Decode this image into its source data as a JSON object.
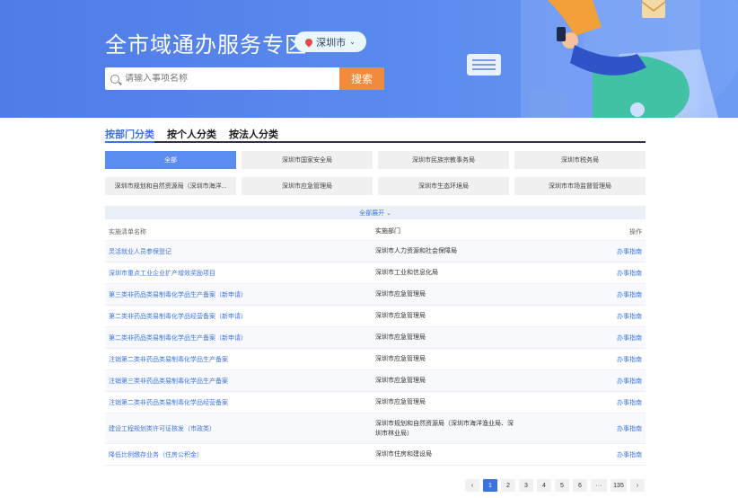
{
  "banner": {
    "title": "全市域通办服务专区",
    "city": "深圳市",
    "search_placeholder": "请输入事项名称",
    "search_button": "搜索"
  },
  "tabs": [
    {
      "label": "按部门分类",
      "active": true
    },
    {
      "label": "按个人分类",
      "active": false
    },
    {
      "label": "按法人分类",
      "active": false
    }
  ],
  "departments": [
    {
      "label": "全部",
      "active": true
    },
    {
      "label": "深圳市国家安全局",
      "active": false
    },
    {
      "label": "深圳市民族宗教事务局",
      "active": false
    },
    {
      "label": "深圳市税务局",
      "active": false
    },
    {
      "label": "深圳市规划和自然资源局（深圳市海洋...",
      "active": false
    },
    {
      "label": "深圳市应急管理局",
      "active": false
    },
    {
      "label": "深圳市生态环境局",
      "active": false
    },
    {
      "label": "深圳市市场监督管理局",
      "active": false
    }
  ],
  "expand_label": "全部展开 ⌄",
  "table": {
    "headers": [
      "实施清单名称",
      "实施部门",
      "操作"
    ],
    "rows": [
      {
        "name": "灵活就业人员参保登记",
        "dept": "深圳市人力资源和社会保障局",
        "action": "办事指南"
      },
      {
        "name": "深圳市重点工业企业扩产增效奖励项目",
        "dept": "深圳市工业和信息化局",
        "action": "办事指南"
      },
      {
        "name": "第三类非药品类易制毒化学品生产备案（新申请）",
        "dept": "深圳市应急管理局",
        "action": "办事指南"
      },
      {
        "name": "第二类非药品类易制毒化学品经营备案（新申请）",
        "dept": "深圳市应急管理局",
        "action": "办事指南"
      },
      {
        "name": "第二类非药品类易制毒化学品生产备案（新申请）",
        "dept": "深圳市应急管理局",
        "action": "办事指南"
      },
      {
        "name": "注销第二类非药品类易制毒化学品生产备案",
        "dept": "深圳市应急管理局",
        "action": "办事指南"
      },
      {
        "name": "注销第三类非药品类易制毒化学品生产备案",
        "dept": "深圳市应急管理局",
        "action": "办事指南"
      },
      {
        "name": "注销第二类非药品类易制毒化学品经营备案",
        "dept": "深圳市应急管理局",
        "action": "办事指南"
      },
      {
        "name": "建设工程规划类许可证核发（市政类）",
        "dept": "深圳市规划和自然资源局（深圳市海洋渔业局、深圳市林业局）",
        "action": "办事指南"
      },
      {
        "name": "降低比例缴存业务（住房公积金）",
        "dept": "深圳市住房和建设局",
        "action": "办事指南"
      }
    ]
  },
  "pagination": {
    "prev": "‹",
    "pages": [
      "1",
      "2",
      "3",
      "4",
      "5",
      "6",
      "···",
      "135"
    ],
    "current": "1",
    "next": "›"
  }
}
